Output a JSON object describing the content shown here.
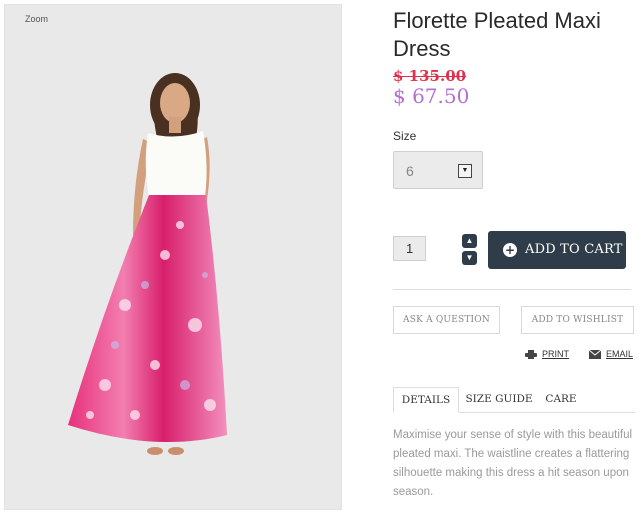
{
  "product": {
    "zoom_label": "Zoom",
    "title": "Florette Pleated Maxi Dress",
    "old_price": "$ 135.00",
    "new_price": "$ 67.50",
    "accent_color": "#b56fd0",
    "sale_color": "#e0304c"
  },
  "options": {
    "size_label": "Size",
    "size_value": "6",
    "quantity": "1"
  },
  "actions": {
    "add_to_cart": "ADD TO CART",
    "ask_question": "ASK A QUESTION",
    "add_to_wishlist": "ADD TO WISHLIST",
    "print": "PRINT",
    "email": "EMAIL",
    "button_color": "#2f3d4a"
  },
  "tabs": [
    {
      "label": "DETAILS",
      "active": true
    },
    {
      "label": "SIZE GUIDE",
      "active": false
    },
    {
      "label": "CARE",
      "active": false
    }
  ],
  "description": "Maximise your sense of style with this beautiful pleated maxi. The waistline creates a flattering silhouette making this dress a hit season upon season.",
  "icons": {
    "print": "printer-icon",
    "email": "envelope-icon",
    "quantity_up": "chevron-up-icon",
    "quantity_down": "chevron-down-icon",
    "cart": "plus-circle-icon",
    "select": "dropdown-arrow-icon"
  }
}
